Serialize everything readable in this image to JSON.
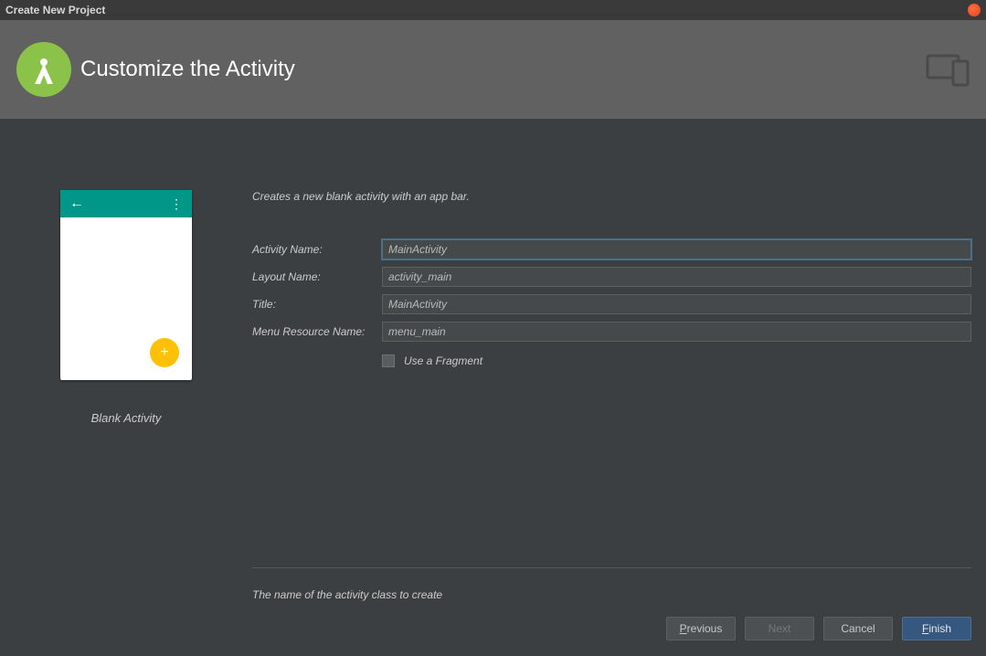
{
  "window": {
    "title": "Create New Project"
  },
  "banner": {
    "title": "Customize the Activity"
  },
  "template": {
    "name": "Blank Activity"
  },
  "form": {
    "description": "Creates a new blank activity with an app bar.",
    "activity_name_label": "Activity Name:",
    "activity_name_value": "MainActivity",
    "layout_name_label": "Layout Name:",
    "layout_name_value": "activity_main",
    "title_label": "Title:",
    "title_value": "MainActivity",
    "menu_resource_label": "Menu Resource Name:",
    "menu_resource_value": "menu_main",
    "use_fragment_label": "Use a Fragment",
    "help_text": "The name of the activity class to create"
  },
  "buttons": {
    "previous": "Previous",
    "next": "Next",
    "cancel": "Cancel",
    "finish": "Finish"
  }
}
